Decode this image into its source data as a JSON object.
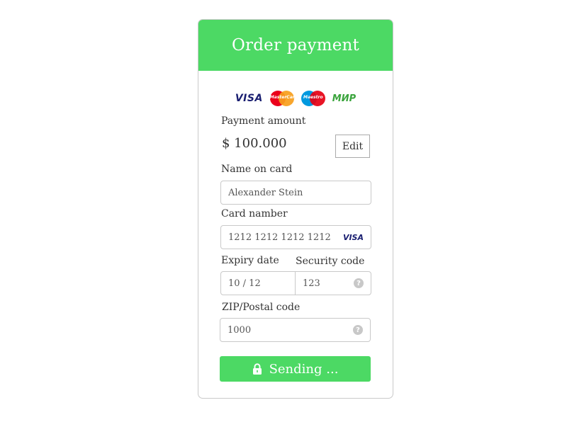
{
  "header": {
    "title": "Order payment"
  },
  "brands": {
    "visa": "VISA",
    "mastercard": "MasterCard",
    "maestro": "Maestro",
    "mir": "МИР"
  },
  "amount": {
    "label": "Payment amount",
    "value": "$ 100.000",
    "edit_label": "Edit"
  },
  "name_on_card": {
    "label": "Name on card",
    "value": "Alexander Stein"
  },
  "card_number": {
    "label": "Card namber",
    "value": "1212 1212 1212 1212",
    "brand": "VISA"
  },
  "expiry": {
    "label": "Expiry date",
    "value": "10 / 12"
  },
  "security": {
    "label": "Security code",
    "value": "123",
    "help": "?"
  },
  "zip": {
    "label": "ZIP/Postal code",
    "value": "1000",
    "help": "?"
  },
  "submit": {
    "label": "Sending ...",
    "icon": "lock-icon"
  },
  "colors": {
    "accent": "#4cd964",
    "visa_blue": "#1a1f71",
    "mir_green": "#3aa43c"
  }
}
